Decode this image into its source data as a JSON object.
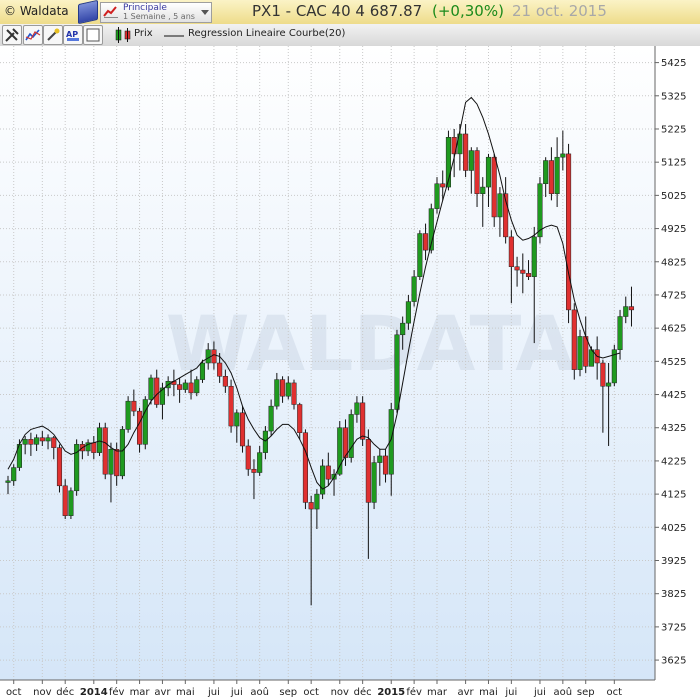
{
  "header": {
    "copyright": "© Waldata",
    "period_title": "Principale",
    "period_sub": "1 Semaine , 5 ans",
    "ticker": "PX1 - CAC 40  4 687.87",
    "change": "(+0,30%)",
    "date": "21 oct. 2015"
  },
  "toolbar": {
    "icons": [
      "tools-icon",
      "indicator-icon",
      "draw-icon",
      "ap-icon",
      "square-icon"
    ],
    "legend_prix": "Prix",
    "legend_reg": "Regression Lineaire Courbe(20)"
  },
  "watermark": "WALDATA",
  "colors": {
    "up": "#1f9a1f",
    "down": "#e03030",
    "line": "#111111",
    "bg_top": "#ffffff",
    "bg_bottom": "#d5e6f8"
  },
  "chart_data": {
    "type": "candlestick",
    "ylim": [
      3565,
      5475
    ],
    "yticks": [
      3625,
      3725,
      3825,
      3925,
      4025,
      4125,
      4225,
      4325,
      4425,
      4525,
      4625,
      4725,
      4825,
      4925,
      5025,
      5125,
      5225,
      5325,
      5425
    ],
    "grid": true,
    "xticks": [
      {
        "label": "oct",
        "i": 1
      },
      {
        "label": "nov",
        "i": 6
      },
      {
        "label": "déc",
        "i": 10
      },
      {
        "label": "2014",
        "i": 15,
        "bold": true
      },
      {
        "label": "fév",
        "i": 19
      },
      {
        "label": "mar",
        "i": 23
      },
      {
        "label": "avr",
        "i": 27
      },
      {
        "label": "mai",
        "i": 31
      },
      {
        "label": "jui",
        "i": 36
      },
      {
        "label": "jui",
        "i": 40
      },
      {
        "label": "aoû",
        "i": 44
      },
      {
        "label": "sep",
        "i": 49
      },
      {
        "label": "oct",
        "i": 53
      },
      {
        "label": "nov",
        "i": 58
      },
      {
        "label": "déc",
        "i": 62
      },
      {
        "label": "2015",
        "i": 67,
        "bold": true
      },
      {
        "label": "fév",
        "i": 71
      },
      {
        "label": "mar",
        "i": 75
      },
      {
        "label": "avr",
        "i": 80
      },
      {
        "label": "mai",
        "i": 84
      },
      {
        "label": "jui",
        "i": 88
      },
      {
        "label": "jui",
        "i": 93
      },
      {
        "label": "aoû",
        "i": 97
      },
      {
        "label": "sep",
        "i": 101
      },
      {
        "label": "oct",
        "i": 106
      }
    ],
    "ohlc": [
      [
        4160,
        4180,
        4125,
        4165
      ],
      [
        4165,
        4215,
        4150,
        4205
      ],
      [
        4205,
        4290,
        4195,
        4275
      ],
      [
        4275,
        4300,
        4245,
        4290
      ],
      [
        4290,
        4310,
        4240,
        4275
      ],
      [
        4275,
        4305,
        4255,
        4295
      ],
      [
        4295,
        4315,
        4270,
        4285
      ],
      [
        4285,
        4305,
        4260,
        4295
      ],
      [
        4295,
        4300,
        4230,
        4265
      ],
      [
        4265,
        4275,
        4130,
        4150
      ],
      [
        4150,
        4170,
        4050,
        4060
      ],
      [
        4060,
        4145,
        4050,
        4135
      ],
      [
        4135,
        4290,
        4120,
        4275
      ],
      [
        4275,
        4285,
        4230,
        4255
      ],
      [
        4255,
        4290,
        4240,
        4280
      ],
      [
        4280,
        4300,
        4230,
        4250
      ],
      [
        4250,
        4340,
        4240,
        4325
      ],
      [
        4325,
        4340,
        4170,
        4185
      ],
      [
        4185,
        4280,
        4100,
        4260
      ],
      [
        4260,
        4280,
        4150,
        4180
      ],
      [
        4180,
        4330,
        4170,
        4320
      ],
      [
        4320,
        4420,
        4310,
        4405
      ],
      [
        4405,
        4440,
        4360,
        4375
      ],
      [
        4375,
        4385,
        4250,
        4275
      ],
      [
        4275,
        4420,
        4260,
        4410
      ],
      [
        4410,
        4485,
        4395,
        4475
      ],
      [
        4475,
        4500,
        4385,
        4395
      ],
      [
        4395,
        4460,
        4350,
        4445
      ],
      [
        4445,
        4480,
        4420,
        4465
      ],
      [
        4465,
        4500,
        4420,
        4455
      ],
      [
        4455,
        4475,
        4400,
        4440
      ],
      [
        4440,
        4470,
        4430,
        4460
      ],
      [
        4460,
        4500,
        4410,
        4430
      ],
      [
        4430,
        4480,
        4420,
        4470
      ],
      [
        4470,
        4530,
        4460,
        4520
      ],
      [
        4520,
        4580,
        4500,
        4560
      ],
      [
        4560,
        4585,
        4500,
        4520
      ],
      [
        4520,
        4550,
        4460,
        4480
      ],
      [
        4480,
        4500,
        4430,
        4450
      ],
      [
        4450,
        4470,
        4310,
        4330
      ],
      [
        4330,
        4380,
        4280,
        4370
      ],
      [
        4370,
        4390,
        4250,
        4270
      ],
      [
        4270,
        4290,
        4180,
        4200
      ],
      [
        4200,
        4230,
        4110,
        4190
      ],
      [
        4190,
        4270,
        4180,
        4250
      ],
      [
        4250,
        4330,
        4230,
        4315
      ],
      [
        4315,
        4410,
        4300,
        4390
      ],
      [
        4390,
        4490,
        4380,
        4470
      ],
      [
        4470,
        4480,
        4400,
        4420
      ],
      [
        4420,
        4480,
        4410,
        4460
      ],
      [
        4460,
        4470,
        4380,
        4395
      ],
      [
        4395,
        4400,
        4290,
        4310
      ],
      [
        4310,
        4320,
        4080,
        4100
      ],
      [
        4100,
        4120,
        3790,
        4080
      ],
      [
        4080,
        4140,
        4020,
        4125
      ],
      [
        4125,
        4230,
        4110,
        4210
      ],
      [
        4210,
        4250,
        4150,
        4170
      ],
      [
        4170,
        4200,
        4120,
        4185
      ],
      [
        4185,
        4345,
        4180,
        4325
      ],
      [
        4325,
        4350,
        4210,
        4235
      ],
      [
        4235,
        4380,
        4220,
        4365
      ],
      [
        4365,
        4420,
        4340,
        4400
      ],
      [
        4400,
        4420,
        4270,
        4290
      ],
      [
        4290,
        4320,
        3930,
        4100
      ],
      [
        4100,
        4240,
        4080,
        4220
      ],
      [
        4220,
        4260,
        4150,
        4240
      ],
      [
        4240,
        4260,
        4160,
        4185
      ],
      [
        4185,
        4400,
        4120,
        4380
      ],
      [
        4380,
        4620,
        4370,
        4605
      ],
      [
        4605,
        4660,
        4560,
        4640
      ],
      [
        4640,
        4725,
        4620,
        4705
      ],
      [
        4705,
        4800,
        4690,
        4780
      ],
      [
        4780,
        4920,
        4770,
        4910
      ],
      [
        4910,
        4940,
        4830,
        4860
      ],
      [
        4860,
        5000,
        4850,
        4985
      ],
      [
        4985,
        5080,
        4970,
        5060
      ],
      [
        5060,
        5100,
        5010,
        5050
      ],
      [
        5050,
        5220,
        5040,
        5200
      ],
      [
        5200,
        5225,
        5080,
        5150
      ],
      [
        5150,
        5240,
        5100,
        5210
      ],
      [
        5210,
        5240,
        5080,
        5100
      ],
      [
        5100,
        5170,
        5030,
        5160
      ],
      [
        5160,
        5170,
        4990,
        5030
      ],
      [
        5030,
        5080,
        4930,
        5050
      ],
      [
        5050,
        5150,
        4990,
        5140
      ],
      [
        5140,
        5150,
        4930,
        4960
      ],
      [
        4960,
        5050,
        4900,
        5030
      ],
      [
        5030,
        5080,
        4880,
        4900
      ],
      [
        4900,
        4920,
        4700,
        4810
      ],
      [
        4810,
        4840,
        4750,
        4800
      ],
      [
        4800,
        4850,
        4730,
        4790
      ],
      [
        4790,
        4830,
        4770,
        4780
      ],
      [
        4780,
        4930,
        4580,
        4900
      ],
      [
        4900,
        5080,
        4880,
        5060
      ],
      [
        5060,
        5140,
        5020,
        5130
      ],
      [
        5130,
        5170,
        5010,
        5030
      ],
      [
        5030,
        5200,
        4990,
        5140
      ],
      [
        5140,
        5220,
        5100,
        5150
      ],
      [
        5150,
        5180,
        4640,
        4680
      ],
      [
        4680,
        4700,
        4470,
        4500
      ],
      [
        4500,
        4620,
        4480,
        4600
      ],
      [
        4600,
        4660,
        4490,
        4510
      ],
      [
        4510,
        4570,
        4510,
        4560
      ],
      [
        4560,
        4600,
        4470,
        4520
      ],
      [
        4520,
        4530,
        4310,
        4450
      ],
      [
        4450,
        4520,
        4270,
        4460
      ],
      [
        4460,
        4575,
        4450,
        4560
      ],
      [
        4560,
        4680,
        4530,
        4660
      ],
      [
        4660,
        4720,
        4640,
        4690
      ],
      [
        4690,
        4750,
        4630,
        4680
      ]
    ],
    "regression": [
      4200,
      4230,
      4275,
      4305,
      4320,
      4325,
      4330,
      4320,
      4305,
      4280,
      4255,
      4245,
      4250,
      4265,
      4275,
      4280,
      4285,
      4280,
      4265,
      4255,
      4255,
      4275,
      4310,
      4340,
      4375,
      4405,
      4425,
      4440,
      4455,
      4465,
      4475,
      4485,
      4495,
      4505,
      4525,
      4535,
      4545,
      4540,
      4520,
      4490,
      4445,
      4390,
      4350,
      4320,
      4295,
      4285,
      4300,
      4320,
      4335,
      4335,
      4320,
      4290,
      4255,
      4205,
      4160,
      4140,
      4150,
      4175,
      4210,
      4240,
      4265,
      4290,
      4300,
      4295,
      4275,
      4260,
      4260,
      4290,
      4365,
      4460,
      4555,
      4645,
      4730,
      4810,
      4880,
      4945,
      5010,
      5070,
      5140,
      5220,
      5305,
      5320,
      5300,
      5260,
      5210,
      5150,
      5085,
      5010,
      4950,
      4905,
      4890,
      4895,
      4905,
      4920,
      4930,
      4935,
      4930,
      4880,
      4790,
      4710,
      4650,
      4600,
      4560,
      4540,
      4535,
      4540,
      4545,
      4550
    ]
  }
}
